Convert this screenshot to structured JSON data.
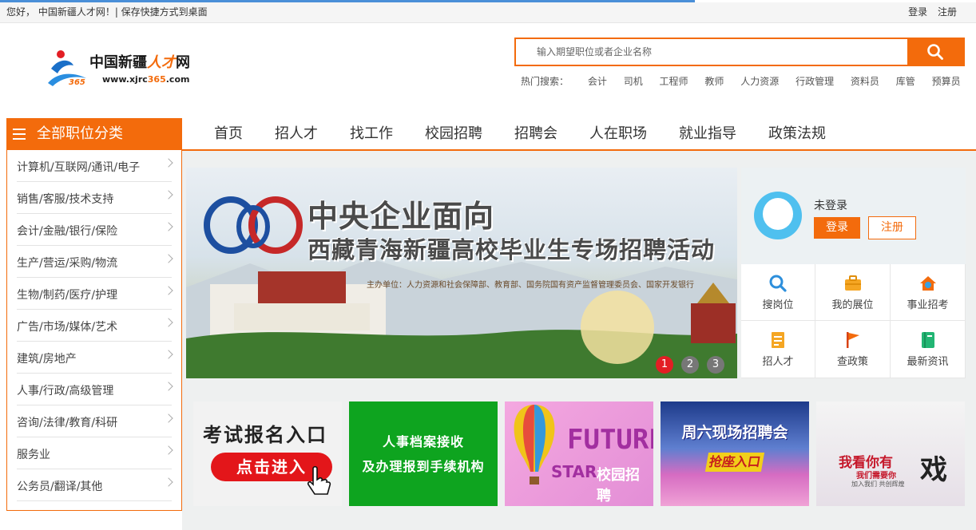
{
  "topbar": {
    "greeting": "您好，  中国新疆人才网！| 保存快捷方式到桌面",
    "login": "登录",
    "register": "注册"
  },
  "logo": {
    "brand_main": "中国新疆",
    "brand_hl": "人才",
    "brand_tail": "网",
    "url_prefix": "www.xjrc",
    "url_num": "365",
    "url_suffix": ".com"
  },
  "search": {
    "placeholder": "输入期望职位或者企业名称",
    "hot_label": "热门搜索：",
    "hot_keywords": [
      "会计",
      "司机",
      "工程师",
      "教师",
      "人力资源",
      "行政管理",
      "资料员",
      "库管",
      "预算员"
    ]
  },
  "category_menu": {
    "title": "全部职位分类",
    "items": [
      "计算机/互联网/通讯/电子",
      "销售/客服/技术支持",
      "会计/金融/银行/保险",
      "生产/营运/采购/物流",
      "生物/制药/医疗/护理",
      "广告/市场/媒体/艺术",
      "建筑/房地产",
      "人事/行政/高级管理",
      "咨询/法律/教育/科研",
      "服务业",
      "公务员/翻译/其他"
    ]
  },
  "nav": [
    "首页",
    "招人才",
    "找工作",
    "校园招聘",
    "招聘会",
    "人在职场",
    "就业指导",
    "政策法规"
  ],
  "banner": {
    "title_line1": "中央企业面向",
    "title_line2": "西藏青海新疆高校毕业生专场招聘活动",
    "subtitle": "主办单位：人力资源和社会保障部、教育部、国务院国有资产监督管理委员会、国家开发银行",
    "dots": [
      "1",
      "2",
      "3"
    ],
    "active_dot": 0
  },
  "user": {
    "status": "未登录",
    "login": "登录",
    "register": "注册",
    "shortcuts": [
      {
        "label": "搜岗位",
        "icon": "search-icon"
      },
      {
        "label": "我的展位",
        "icon": "briefcase-icon"
      },
      {
        "label": "事业招考",
        "icon": "home-icon"
      },
      {
        "label": "招人才",
        "icon": "document-icon"
      },
      {
        "label": "查政策",
        "icon": "flag-icon"
      },
      {
        "label": "最新资讯",
        "icon": "book-icon"
      }
    ]
  },
  "ads": {
    "exam": {
      "line1": "考试报名入口",
      "button": "点击进入"
    },
    "archive": {
      "line1": "人事档案接收",
      "line2": "及办理报到手续机构"
    },
    "campus": {
      "line1": "FUTURE",
      "line2": "STAR",
      "line3": "校园招聘"
    },
    "saturday": {
      "line1": "周六现场招聘会",
      "button": "抢座入口"
    },
    "join": {
      "line1": "我看你有",
      "line2": "我们需要你",
      "line3": "加入我们 共创辉煌",
      "big": "戏"
    }
  },
  "colors": {
    "accent": "#f36b0c",
    "banner_dot_active": "#e31e24",
    "archive_green": "#0ea41f",
    "avatar_blue": "#4fc0ef"
  }
}
